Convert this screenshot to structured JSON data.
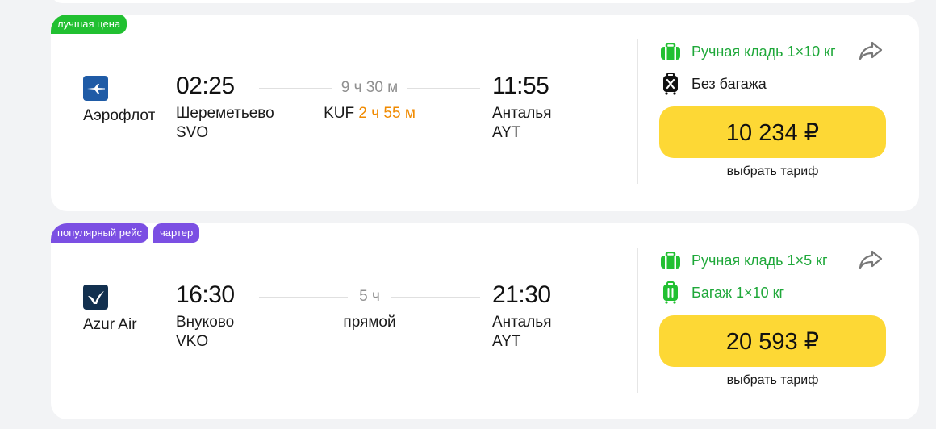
{
  "flights": [
    {
      "badges": [
        "лучшая цена"
      ],
      "airline": "Аэрофлот",
      "dep_time": "02:25",
      "dep_city": "Шереметьево",
      "dep_code": "SVO",
      "duration": "9 ч 30 м",
      "stop_code": "KUF",
      "stop_layover": "2 ч 55 м",
      "arr_time": "11:55",
      "arr_city": "Анталья",
      "arr_code": "AYT",
      "hand_luggage": "Ручная кладь 1×10 кг",
      "baggage": "Без багажа",
      "price": "10 234 ₽",
      "fare_link": "выбрать тариф"
    },
    {
      "badges": [
        "популярный рейс",
        "чартер"
      ],
      "airline": "Azur Air",
      "dep_time": "16:30",
      "dep_city": "Внуково",
      "dep_code": "VKO",
      "duration": "5 ч",
      "direct_label": "прямой",
      "arr_time": "21:30",
      "arr_city": "Анталья",
      "arr_code": "AYT",
      "hand_luggage": "Ручная кладь 1×5 кг",
      "baggage": "Багаж 1×10 кг",
      "price": "20 593 ₽",
      "fare_link": "выбрать тариф"
    }
  ],
  "colors": {
    "badge_green": "#21c031",
    "badge_purple": "#7b4fe3",
    "price_button": "#fdd835",
    "layover": "#f08a00",
    "luggage_green": "#1fa83a",
    "aeroflot_blue": "#1f5ba6",
    "azur_navy": "#12304f"
  },
  "icons": [
    "aeroflot-logo",
    "azur-air-logo",
    "hand-luggage-icon",
    "no-baggage-icon",
    "baggage-icon",
    "share-icon"
  ]
}
